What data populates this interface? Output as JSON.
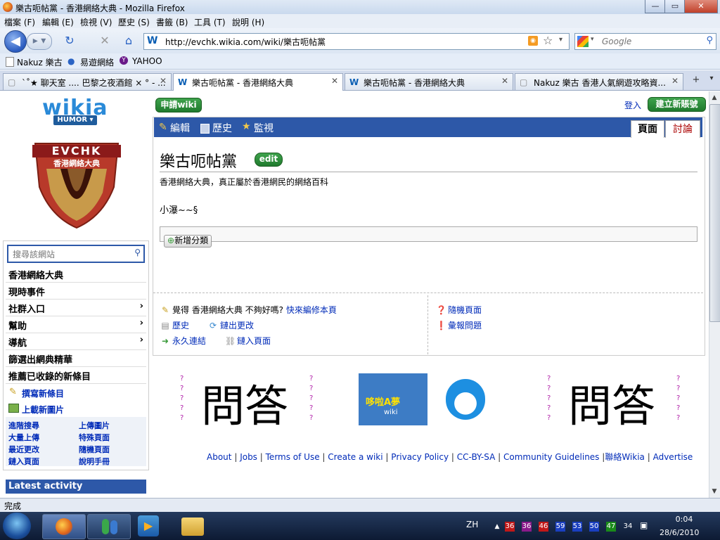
{
  "window": {
    "title": "樂古呃帖黨 - 香港網絡大典 - Mozilla Firefox",
    "minimize": "—",
    "maximize": "▭",
    "close": "✕"
  },
  "menu": [
    "檔案 (F)",
    "編輯 (E)",
    "檢視 (V)",
    "歷史 (S)",
    "書籤 (B)",
    "工具 (T)",
    "說明 (H)"
  ],
  "toolbar": {
    "url": "http://evchk.wikia.com/wiki/樂古呃帖黨",
    "search_placeholder": "Google"
  },
  "bookmarks": [
    "Nakuz 樂古",
    "易遊網絡",
    "YAHOO"
  ],
  "tabs": [
    {
      "label": "`˚★ 聊天室 .... 巴黎之夜酒館 × ° - ...",
      "active": false
    },
    {
      "label": "樂古呃帖黨 - 香港網絡大典",
      "active": true
    },
    {
      "label": "樂古呃帖黨 - 香港網絡大典",
      "active": false
    },
    {
      "label": "Nakuz 樂古 香港人氣網遊攻略資...",
      "active": false
    }
  ],
  "header": {
    "logo": "wikia",
    "hub": "HUMOR ▾",
    "site_logo_top": "EVCHK",
    "site_logo_sub": "香港網絡大典",
    "request_wiki": "申請wiki",
    "login": "登入",
    "create_account": "建立新賬號"
  },
  "sidebar": {
    "search_placeholder": "搜尋該網站",
    "items": [
      {
        "label": "香港網絡大典",
        "chevron": ""
      },
      {
        "label": "現時事件",
        "chevron": ""
      },
      {
        "label": "社群入口",
        "chevron": "›"
      },
      {
        "label": "幫助",
        "chevron": "›"
      },
      {
        "label": "導航",
        "chevron": "›"
      },
      {
        "label": "篩選出網典精華",
        "chevron": ""
      },
      {
        "label": "推薦已收錄的新條目",
        "chevron": ""
      }
    ],
    "write_new": "撰寫新條目",
    "upload_image": "上載新圖片",
    "links": [
      "進階搜尋",
      "上傳圖片",
      "大量上傳",
      "特殊頁面",
      "最近更改",
      "隨機頁面",
      "鏈入頁面",
      "說明手冊"
    ],
    "latest_activity": "Latest activity"
  },
  "article": {
    "actions": [
      "編輯",
      "歷史",
      "監視"
    ],
    "tab_page": "頁面",
    "tab_talk": "討論",
    "title": "樂古呃帖黨",
    "edit_badge": "edit",
    "subtitle": "香港網絡大典，真正屬於香港網民的網絡百科",
    "signature": "小瀑~~§",
    "add_category": "新增分類",
    "footer": {
      "prompt_prefix": "覺得 香港網絡大典 不夠好嗎?",
      "prompt_link": "快來編修本頁",
      "history": "歷史",
      "watch_changes": "鏈出更改",
      "permalink": "永久連結",
      "what_links_here": "鏈入頁面",
      "random_page": "隨機頁面",
      "report_problem": "彙報問題"
    }
  },
  "ads": {
    "left_text": "問答",
    "mid_text": "哆啦A夢",
    "mid_sub": "wiki",
    "right_text": "問答",
    "q": "?"
  },
  "site_footer": [
    "About",
    "Jobs",
    "Terms of Use",
    "Create a wiki",
    "Privacy Policy",
    "CC-BY-SA",
    "Community Guidelines",
    "聯絡Wikia",
    "Advertise"
  ],
  "status": "完成",
  "taskbar": {
    "lang": "ZH",
    "tray_numbers": [
      "36",
      "36",
      "46",
      "59",
      "53",
      "50",
      "47",
      "34"
    ],
    "tray_colors": [
      "#c01818",
      "#8a1a8a",
      "#c01818",
      "#1a3fc0",
      "#1a3fc0",
      "#1a3fc0",
      "#1a8a1a",
      "#203050"
    ],
    "time": "0:04",
    "date": "28/6/2010"
  }
}
